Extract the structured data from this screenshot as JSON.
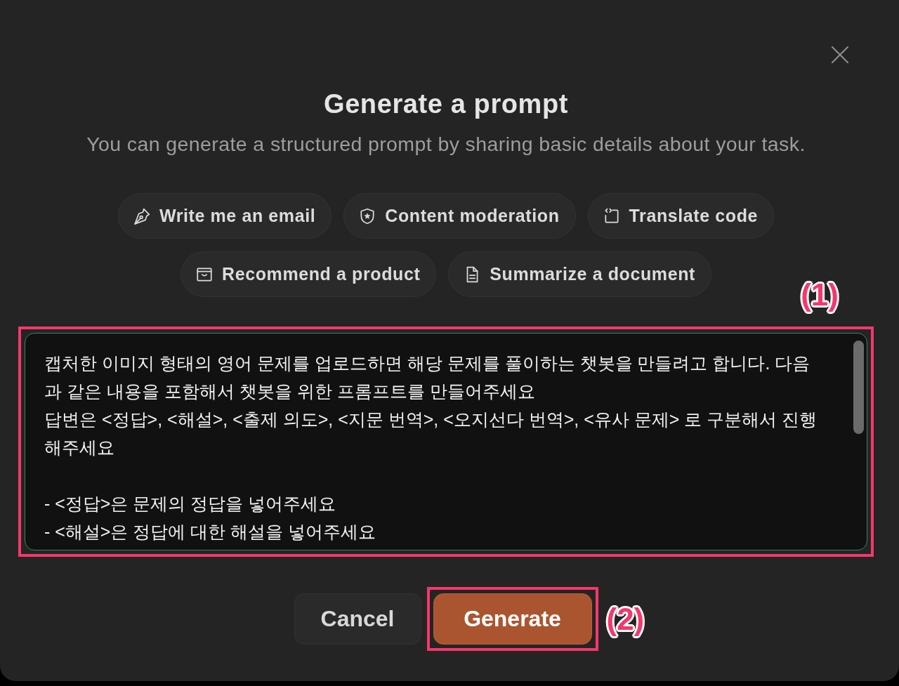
{
  "dialog": {
    "title": "Generate a prompt",
    "subtitle": "You can generate a structured prompt by sharing basic details about your task.",
    "examples": [
      {
        "label": "Write me an email",
        "kind": "email"
      },
      {
        "label": "Content moderation",
        "kind": "moderation"
      },
      {
        "label": "Translate code",
        "kind": "translate"
      },
      {
        "label": "Recommend a product",
        "kind": "recommend"
      },
      {
        "label": "Summarize a document",
        "kind": "summarize"
      }
    ],
    "prompt_field": {
      "value": "캡처한 이미지 형태의 영어 문제를 업로드하면 해당 문제를 풀이하는 챗봇을 만들려고 합니다. 다음과 같은 내용을 포함해서 챗봇을 위한 프롬프트를 만들어주세요\n답변은 <정답>, <해설>, <출제 의도>, <지문 번역>, <오지선다 번역>, <유사 문제> 로 구분해서 진행해주세요\n\n- <정답>은 문제의 정답을 넣어주세요\n- <해설>은 정답에 대한 해설을 넣어주세요",
      "callout": "(1)"
    },
    "buttons": [
      {
        "label": "Cancel",
        "kind": "secondary"
      },
      {
        "label": "Generate",
        "kind": "primary",
        "callout": "(2)"
      }
    ]
  }
}
